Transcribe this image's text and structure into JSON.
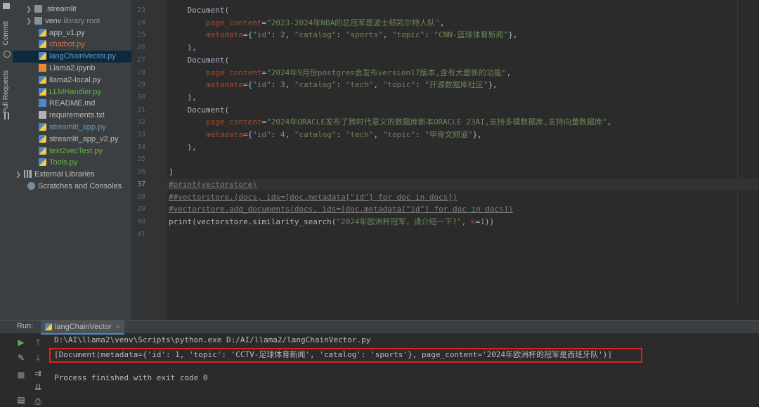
{
  "left_strip": {
    "commit": "Commit",
    "pull_requests": "Pull Requests"
  },
  "project_tree": {
    "items": [
      {
        "label": ".streamlit",
        "type": "folder",
        "expandable": true,
        "color": "#bbbbbb"
      },
      {
        "label": "venv",
        "suffix": "library root",
        "type": "folder",
        "expandable": true,
        "color": "#bbbbbb"
      },
      {
        "label": "app_v1.py",
        "type": "py",
        "color": "#bbbbbb"
      },
      {
        "label": "chatbot.py",
        "type": "py",
        "color": "#d0714a"
      },
      {
        "label": "langChainVector.py",
        "type": "py",
        "color": "#6897bb",
        "selected": true
      },
      {
        "label": "Llama2.ipynb",
        "type": "nb",
        "color": "#bbbbbb"
      },
      {
        "label": "llama2-local.py",
        "type": "py",
        "color": "#bbbbbb"
      },
      {
        "label": "LLMHandler.py",
        "type": "py",
        "color": "#62b543"
      },
      {
        "label": "README.md",
        "type": "md",
        "color": "#bbbbbb"
      },
      {
        "label": "requirements.txt",
        "type": "doc",
        "color": "#bbbbbb"
      },
      {
        "label": "streamlit_app.py",
        "type": "py",
        "color": "#6897bb"
      },
      {
        "label": "streamlit_app_v2.py",
        "type": "py",
        "color": "#bbbbbb"
      },
      {
        "label": "text2vecTest.py",
        "type": "py",
        "color": "#62b543"
      },
      {
        "label": "Tools.py",
        "type": "py",
        "color": "#62b543"
      }
    ],
    "external_libraries": "External Libraries",
    "scratches": "Scratches and Consoles"
  },
  "editor": {
    "current_line": "37",
    "lines": [
      {
        "n": "23",
        "code": "    Document("
      },
      {
        "n": "24",
        "code": "        page_content=\"2023-2024年NBA的总冠军是波士顿凯尔特人队\","
      },
      {
        "n": "25",
        "code": "        metadata={\"id\": 2, \"catalog\": \"sports\", \"topic\": \"CNN-篮球体育新闻\"},"
      },
      {
        "n": "26",
        "code": "    ),"
      },
      {
        "n": "27",
        "code": "    Document("
      },
      {
        "n": "28",
        "code": "        page_content=\"2024年9月份postgres会发布version17版本,含有大量新的功能\","
      },
      {
        "n": "29",
        "code": "        metadata={\"id\": 3, \"catalog\": \"tech\", \"topic\": \"开源数据库社区\"},"
      },
      {
        "n": "30",
        "code": "    ),"
      },
      {
        "n": "31",
        "code": "    Document("
      },
      {
        "n": "32",
        "code": "        page_content=\"2024年ORACLE发布了跨时代意义的数据库新本ORACLE 23AI,支持多模数据库,支持向量数据库\","
      },
      {
        "n": "33",
        "code": "        metadata={\"id\": 4, \"catalog\": \"tech\", \"topic\": \"甲骨文频道\"},"
      },
      {
        "n": "34",
        "code": "    ),"
      },
      {
        "n": "35",
        "code": ""
      },
      {
        "n": "36",
        "code": "]"
      },
      {
        "n": "37",
        "code": "#print(vectorstore)"
      },
      {
        "n": "38",
        "code": "##vectorstore.(docs, ids=[doc.metadata[\"id\"] for doc in docs])"
      },
      {
        "n": "39",
        "code": "#vectorstore.add_documents(docs, ids=[doc.metadata[\"id\"] for doc in docs])"
      },
      {
        "n": "40",
        "code": "print(vectorstore.similarity_search(\"2024年欧洲杯冠军，请介绍一下?\", k=1))"
      },
      {
        "n": "41",
        "code": ""
      }
    ]
  },
  "run_panel": {
    "label": "Run:",
    "tab": "langChainVector",
    "tab_close": "×",
    "command": "D:\\AI\\llama2\\venv\\Scripts\\python.exe D:/AI/llama2/langChainVector.py",
    "result": "[Document(metadata={'id': 1, 'topic': 'CCTV-足球体育新闻', 'catalog': 'sports'}, page_content='2024年欧洲杯的冠军是西班牙队')]",
    "exit": "Process finished with exit code 0"
  }
}
